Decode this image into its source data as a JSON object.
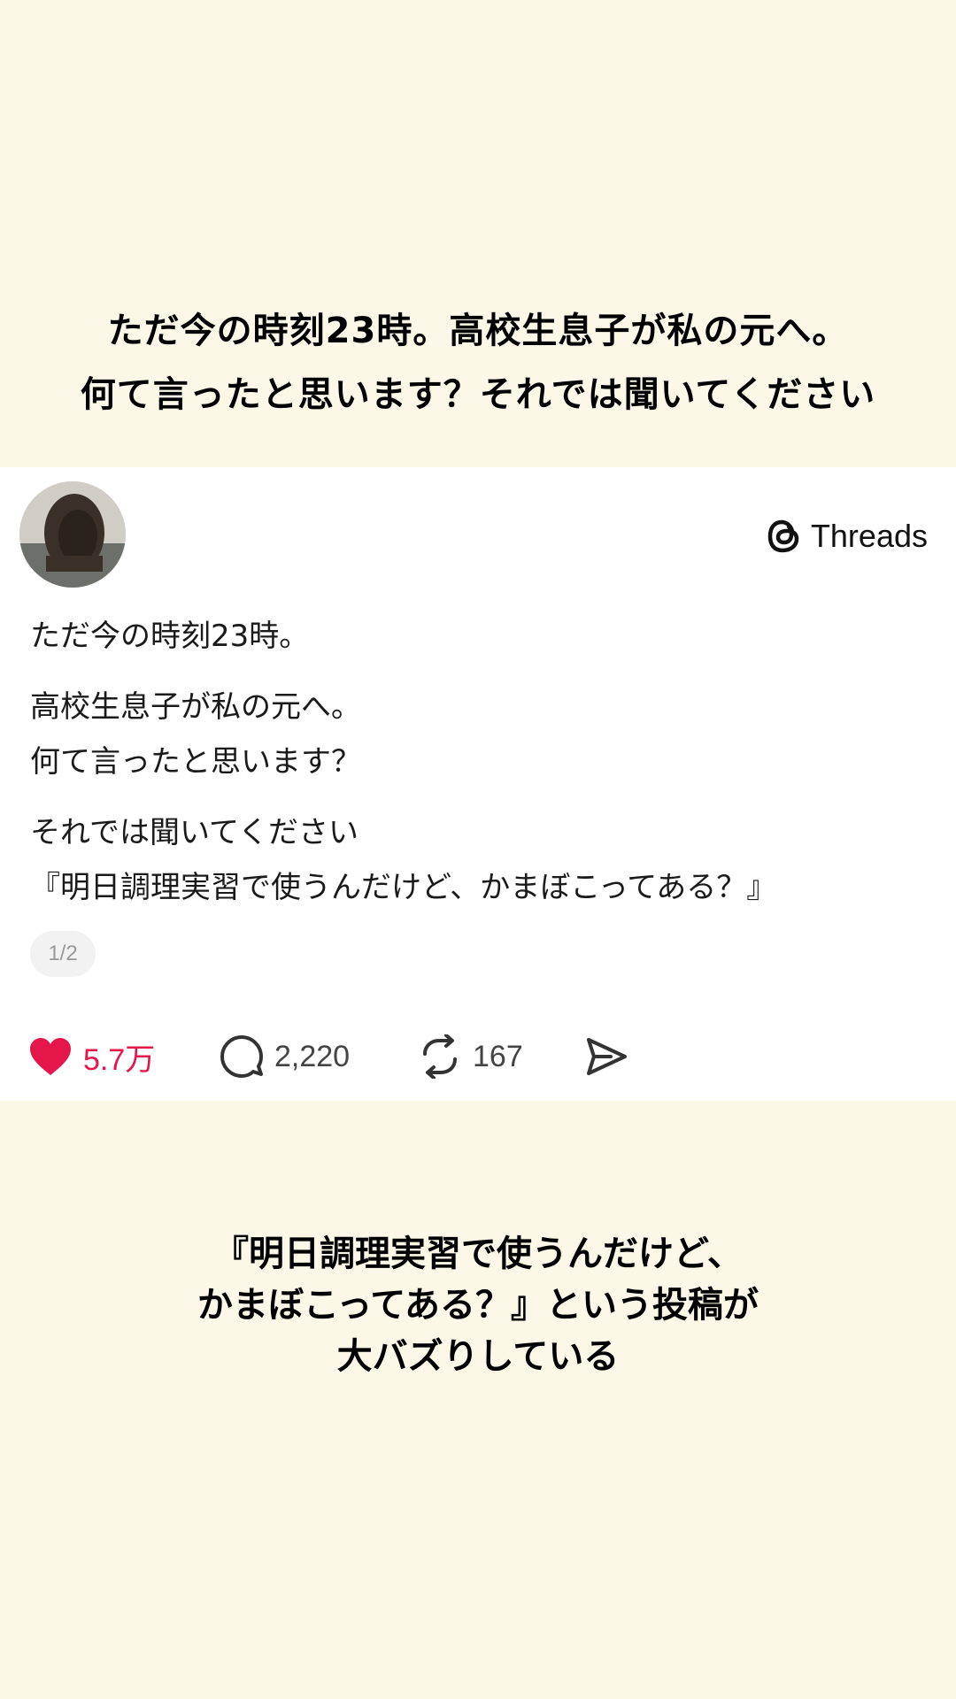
{
  "headline": {
    "line1": "ただ今の時刻23時。高校生息子が私の元へ。",
    "line2": "何て言ったと思います？それでは聞いてください"
  },
  "post": {
    "brand": "Threads",
    "paragraphs": [
      "ただ今の時刻23時。",
      "高校生息子が私の元へ。",
      "何て言ったと思います？",
      "それでは聞いてください",
      "『明日調理実習で使うんだけど、かまぼこってある？』"
    ],
    "page_indicator": "1/2",
    "likes": "5.7万",
    "replies": "2,220",
    "reposts": "167",
    "colors": {
      "like": "#e5174a",
      "background": "#fcf8e8"
    }
  },
  "caption": {
    "line1": "『明日調理実習で使うんだけど、",
    "line2": "かまぼこってある？』という投稿が",
    "line3": "大バズりしている"
  }
}
